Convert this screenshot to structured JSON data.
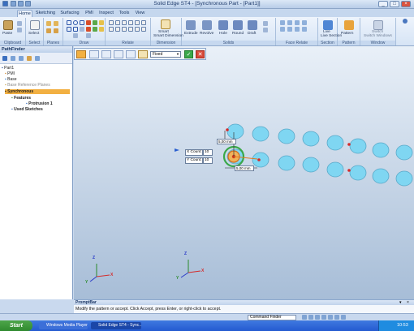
{
  "window": {
    "title": "Solid Edge ST4 - [Synchronous Part - [Part1]]"
  },
  "tabs": [
    "Home",
    "Sketching",
    "Surfacing",
    "PMI",
    "Inspect",
    "Tools",
    "View"
  ],
  "ribbon": {
    "paste": "Paste",
    "select": "Select",
    "smart_dimension": "Smart Dimension",
    "extrude": "Extrude",
    "revolve": "Revolve",
    "hole": "Hole",
    "round": "Round",
    "draft": "Draft",
    "live_section": "Live Section",
    "pattern": "Pattern",
    "switch_windows": "Switch Windows",
    "groups": [
      "Clipboard",
      "Select",
      "Planes",
      "Draw",
      "Relate",
      "Dimension",
      "Solids",
      "Face Relate",
      "Section",
      "Pattern",
      "Window"
    ]
  },
  "command_bar": {
    "mode_value": "Fixed",
    "accept_icon": "check-icon",
    "cancel_icon": "x-icon"
  },
  "pathfinder": {
    "title": "PathFinder",
    "items": [
      {
        "label": "Part1"
      },
      {
        "label": "PMI"
      },
      {
        "label": "Base"
      },
      {
        "label": "Base Reference Planes"
      },
      {
        "label": "Synchronous"
      },
      {
        "label": "Features"
      },
      {
        "label": "Protrusion 1"
      },
      {
        "label": "Used Sketches"
      }
    ]
  },
  "viewport": {
    "x_count_label": "X Count:",
    "x_count_value": "10",
    "y_count_label": "Y Count:",
    "y_count_value": "10",
    "dim_vertical": "5,00 mm",
    "dim_horizontal": "5,00 mm",
    "axis_x": "X",
    "axis_y": "Y",
    "axis_z": "Z"
  },
  "prompt": {
    "title": "PromptBar",
    "message": "Modify the pattern or accept.  Click Accept, press Enter, or right-click to accept."
  },
  "status": {
    "command_finder": "Command Finder"
  },
  "taskbar": {
    "start": "Start",
    "tasks": [
      "Windows Media Player",
      "Solid Edge ST4 - Sync..."
    ],
    "clock": "10:53"
  },
  "colors": {
    "disk": "#7fd6f2",
    "accent": "#e07a1f",
    "ribbon_bg": "#dfe9f7"
  }
}
